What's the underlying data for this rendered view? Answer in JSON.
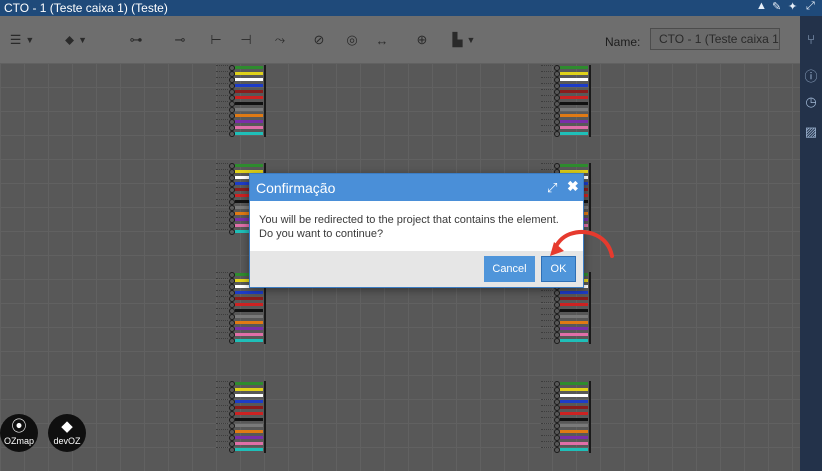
{
  "window": {
    "title": "CTO - 1 (Teste caixa 1) (Teste)",
    "controls": [
      "collapse",
      "edit",
      "settings",
      "maximize"
    ]
  },
  "toolbar": {
    "name_label": "Name:",
    "name_value": "CTO - 1 (Teste caixa 1)"
  },
  "sidebar": {
    "items": [
      "splitter-icon",
      "info-icon",
      "history-icon",
      "image-icon"
    ]
  },
  "dialog": {
    "title": "Confirmação",
    "message_line1": "You will be redirected to the project that contains the element.",
    "message_line2": "Do you want to continue?",
    "cancel_label": "Cancel",
    "ok_label": "OK"
  },
  "annotation": {
    "color": "#e63a2e"
  },
  "logos": [
    {
      "mark": "⦿",
      "text": "OZmap"
    },
    {
      "mark": "◆",
      "text": "devOZ"
    }
  ],
  "fiber_colors": [
    "#2e8b2e",
    "#e0d21a",
    "#ffffff",
    "#1d3cc8",
    "#8a1c1c",
    "#cc2222",
    "#111111",
    "#7a7a7a",
    "#e07a14",
    "#7a2ea8",
    "#e06fa8",
    "#1fbfb8"
  ]
}
